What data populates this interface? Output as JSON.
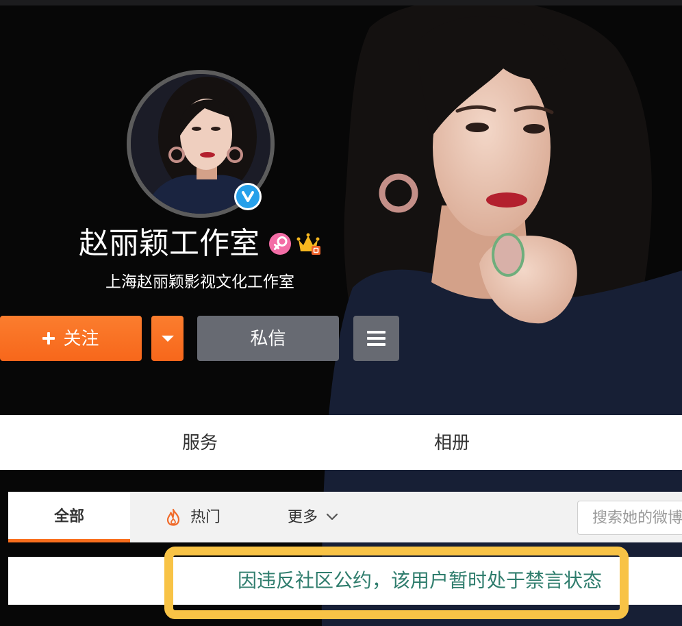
{
  "profile": {
    "name": "赵丽颖工作室",
    "subtitle": "上海赵丽颖影视文化工作室",
    "badges": [
      "verified-icon",
      "female-icon",
      "crown-icon"
    ]
  },
  "actions": {
    "follow_label": "关注",
    "message_label": "私信",
    "icons": [
      "plus-icon",
      "caret-down-icon",
      "menu-icon"
    ]
  },
  "nav": {
    "items": [
      {
        "label": "服务"
      },
      {
        "label": "相册"
      }
    ]
  },
  "tabs": {
    "items": [
      {
        "label": "全部",
        "active": true
      },
      {
        "label": "热门",
        "icon": "flame-icon"
      },
      {
        "label": "更多",
        "icon": "chevron-down-icon"
      }
    ],
    "search_placeholder": "搜索她的微博"
  },
  "notice": {
    "text": "因违反社区公约，该用户暂时处于禁言状态"
  },
  "colors": {
    "accent": "#f96f1e",
    "secondary_button": "#676a72",
    "notice_text": "#2f7d6d",
    "highlight": "#f8c346",
    "verified": "#27a0ea",
    "female": "#f36da6"
  }
}
